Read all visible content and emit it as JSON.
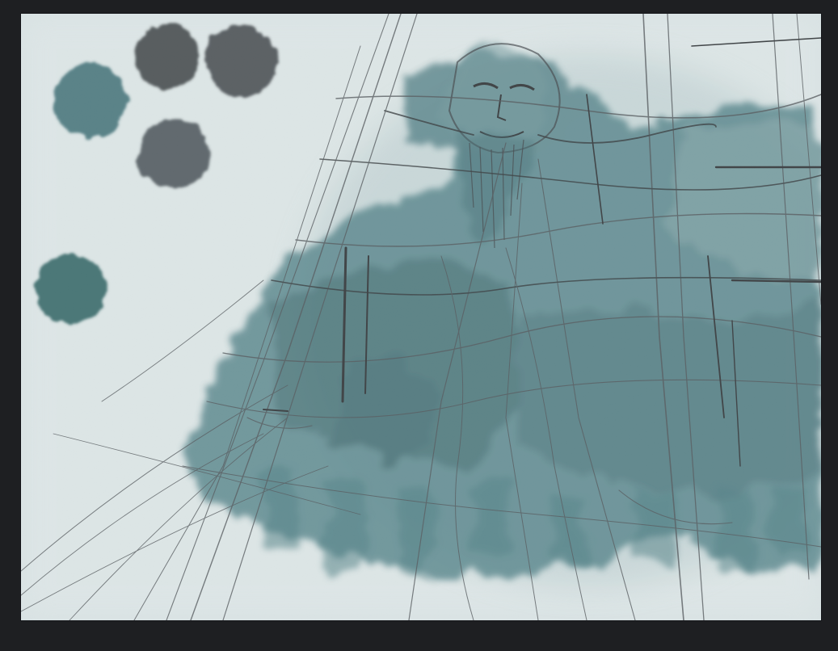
{
  "app": {
    "workspace_background": "#1e1f22"
  },
  "canvas": {
    "paper_color": "#d8e2e3",
    "wash_color": "#3f6f76",
    "deep_wash_color": "#2f5d63",
    "graphite_color": "#4b4f53",
    "dark_graphite_color": "#2e3134"
  },
  "swatches": [
    {
      "color": "#3e6d74"
    },
    {
      "color": "#3f4347"
    },
    {
      "color": "#45494d"
    },
    {
      "color": "#4b5258"
    },
    {
      "color": "#2f6263"
    }
  ]
}
